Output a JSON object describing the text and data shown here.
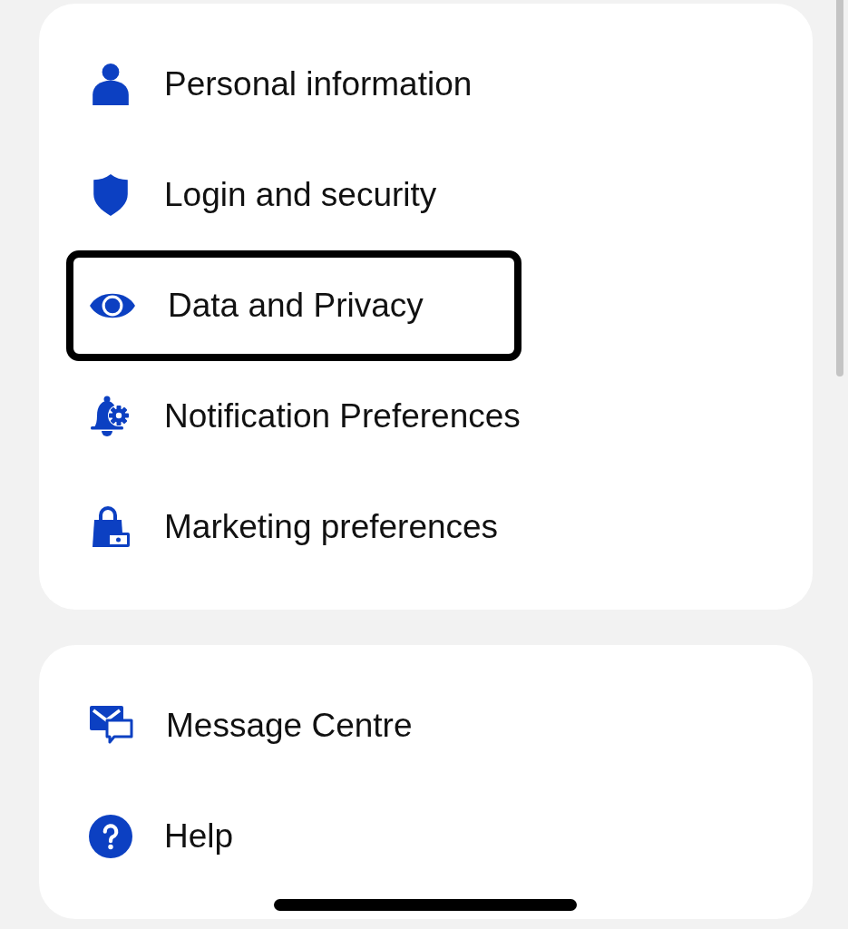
{
  "sections": [
    {
      "items": [
        {
          "label": "Personal information",
          "highlighted": false
        },
        {
          "label": "Login and security",
          "highlighted": false
        },
        {
          "label": "Data and Privacy",
          "highlighted": true
        },
        {
          "label": "Notification Preferences",
          "highlighted": false
        },
        {
          "label": "Marketing preferences",
          "highlighted": false
        }
      ]
    },
    {
      "items": [
        {
          "label": "Message Centre",
          "highlighted": false
        },
        {
          "label": "Help",
          "highlighted": false
        }
      ]
    }
  ]
}
